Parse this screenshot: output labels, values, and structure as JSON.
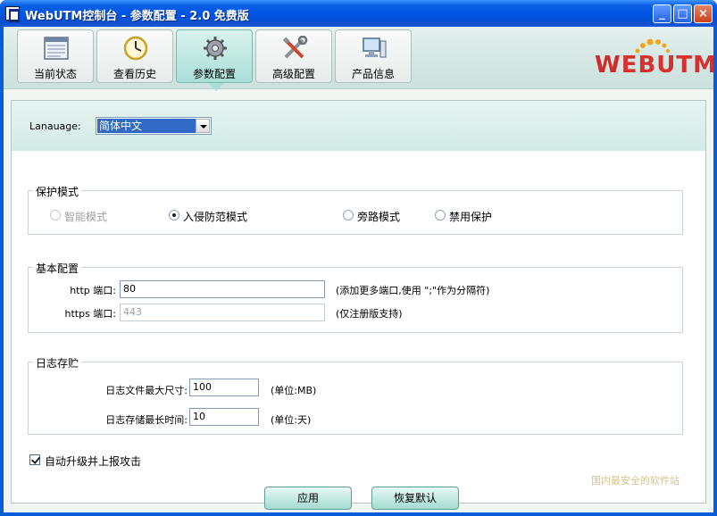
{
  "window": {
    "title": "WebUTM控制台 - 参数配置 - 2.0 免费版",
    "controls": {
      "minimize": "_",
      "maximize": "□",
      "close": "×"
    }
  },
  "nav": {
    "tabs": [
      {
        "label": "当前状态",
        "icon": "status-panel-icon",
        "active": false
      },
      {
        "label": "查看历史",
        "icon": "clock-icon",
        "active": false
      },
      {
        "label": "参数配置",
        "icon": "gear-icon",
        "active": true
      },
      {
        "label": "高级配置",
        "icon": "tools-icon",
        "active": false
      },
      {
        "label": "产品信息",
        "icon": "computer-icon",
        "active": false
      }
    ]
  },
  "logo": {
    "prefix": "W",
    "rest": "EBUTM"
  },
  "language": {
    "label": "Lanauage:",
    "selected": "简体中文"
  },
  "protection": {
    "title": "保护模式",
    "options": [
      {
        "label": "智能模式",
        "selected": false,
        "disabled": true
      },
      {
        "label": "入侵防范模式",
        "selected": true,
        "disabled": false
      },
      {
        "label": "旁路模式",
        "selected": false,
        "disabled": false
      },
      {
        "label": "禁用保护",
        "selected": false,
        "disabled": false
      }
    ]
  },
  "basic": {
    "title": "基本配置",
    "http_label": "http 端口:",
    "http_value": "80",
    "http_hint": "(添加更多端口,使用 \";\"作为分隔符)",
    "https_label": "https 端口:",
    "https_value": "443",
    "https_hint": "(仅注册版支持)"
  },
  "log": {
    "title": "日志存贮",
    "size_label": "日志文件最大尺寸:",
    "size_value": "100",
    "size_unit": "(单位:MB)",
    "time_label": "日志存储最长时间:",
    "time_value": "10",
    "time_unit": "(单位:天)"
  },
  "auto_upgrade": {
    "label": "自动升级并上报攻击",
    "checked": true
  },
  "buttons": {
    "apply": "应用",
    "restore": "恢复默认"
  },
  "watermark": {
    "text": "国内最安全的软件站"
  },
  "colors": {
    "accent": "#a9dfd6",
    "title_bar": "#0054e3",
    "brand_red": "#d22a2a"
  }
}
